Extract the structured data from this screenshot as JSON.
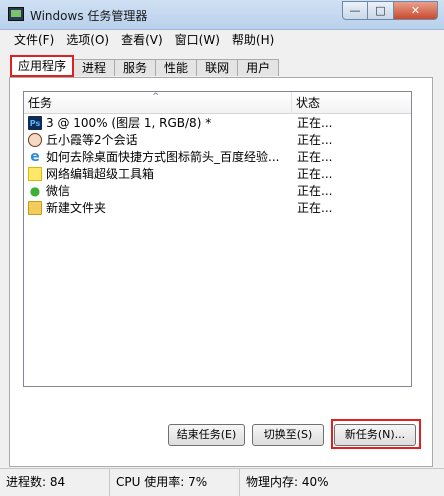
{
  "window": {
    "title": "Windows 任务管理器",
    "controls": {
      "minimize": "—",
      "maximize": "□",
      "close": "✕"
    }
  },
  "menu": [
    "文件(F)",
    "选项(O)",
    "查看(V)",
    "窗口(W)",
    "帮助(H)"
  ],
  "tabs": [
    {
      "label": "应用程序",
      "active": true
    },
    {
      "label": "进程",
      "active": false
    },
    {
      "label": "服务",
      "active": false
    },
    {
      "label": "性能",
      "active": false
    },
    {
      "label": "联网",
      "active": false
    },
    {
      "label": "用户",
      "active": false
    }
  ],
  "task_list": {
    "columns": {
      "task": "任务",
      "status": "状态"
    },
    "sort_indicator": "^",
    "rows": [
      {
        "icon": "photoshop-icon",
        "icon_text": "Ps",
        "name": "3 @ 100% (图层 1, RGB/8) *",
        "status": "正在..."
      },
      {
        "icon": "qq-avatar-icon",
        "icon_text": "",
        "name": "丘小霞等2个会话",
        "status": "正在..."
      },
      {
        "icon": "ie-browser-icon",
        "icon_text": "e",
        "name": "如何去除桌面快捷方式图标箭头_百度经验...",
        "status": "正在..."
      },
      {
        "icon": "sticky-note-icon",
        "icon_text": "",
        "name": "网络编辑超级工具箱",
        "status": "正在..."
      },
      {
        "icon": "wechat-icon",
        "icon_text": "●",
        "name": "微信",
        "status": "正在..."
      },
      {
        "icon": "folder-icon",
        "icon_text": "",
        "name": "新建文件夹",
        "status": "正在..."
      }
    ]
  },
  "buttons": {
    "end_task": "结束任务(E)",
    "switch_to": "切换至(S)",
    "new_task": "新任务(N)..."
  },
  "statusbar": {
    "processes": "进程数: 84",
    "cpu": "CPU 使用率: 7%",
    "memory": "物理内存: 40%"
  }
}
